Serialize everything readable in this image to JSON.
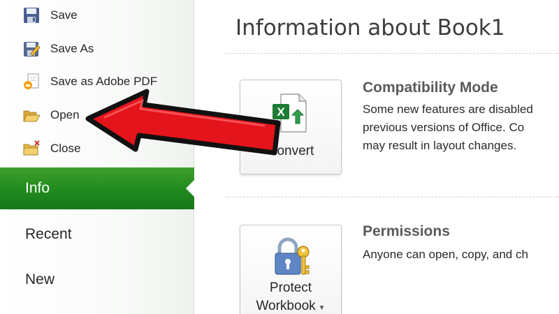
{
  "sidebar": {
    "commands": [
      {
        "label": "Save",
        "icon": "save-icon"
      },
      {
        "label": "Save As",
        "icon": "save-as-icon"
      },
      {
        "label": "Save as Adobe PDF",
        "icon": "pdf-icon"
      },
      {
        "label": "Open",
        "icon": "folder-open-icon"
      },
      {
        "label": "Close",
        "icon": "folder-close-icon"
      }
    ],
    "tabs": [
      {
        "label": "Info",
        "selected": true
      },
      {
        "label": "Recent",
        "selected": false
      },
      {
        "label": "New",
        "selected": false
      }
    ]
  },
  "main": {
    "title": "Information about Book1",
    "compatibility": {
      "button_label": "Convert",
      "heading": "Compatibility Mode",
      "lines": [
        "Some new features are disabled",
        "previous versions of Office. Co",
        "may result in layout changes."
      ]
    },
    "permissions": {
      "button_label_1": "Protect",
      "button_label_2": "Workbook",
      "heading": "Permissions",
      "lines": [
        "Anyone can open, copy, and ch"
      ]
    }
  },
  "annotation": {
    "type": "red-arrow",
    "points_to": "Open"
  },
  "colors": {
    "info_tab": "#218a1e",
    "arrow_fill": "#e3141b",
    "arrow_outline": "#111111",
    "excel_green": "#1e7b34"
  }
}
